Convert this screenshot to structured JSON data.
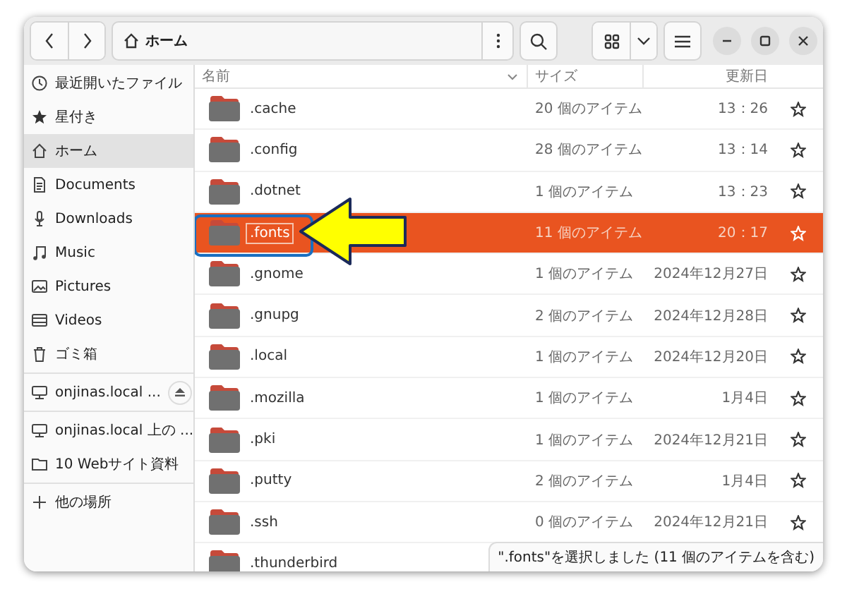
{
  "header": {
    "location": "ホーム"
  },
  "sidebar": {
    "sections": [
      [
        {
          "label": "最近開いたファイル",
          "selected": false
        },
        {
          "label": "星付き",
          "selected": false
        },
        {
          "label": "ホーム",
          "selected": true
        },
        {
          "label": "Documents",
          "selected": false
        },
        {
          "label": "Downloads",
          "selected": false
        },
        {
          "label": "Music",
          "selected": false
        },
        {
          "label": "Pictures",
          "selected": false
        },
        {
          "label": "Videos",
          "selected": false
        },
        {
          "label": "ゴミ箱",
          "selected": false
        }
      ],
      [
        {
          "label": "onjinas.local ...",
          "selected": false,
          "eject": true
        }
      ],
      [
        {
          "label": "onjinas.local 上の ...",
          "selected": false
        },
        {
          "label": "10 Webサイト資料",
          "selected": false
        }
      ],
      [
        {
          "label": "他の場所",
          "selected": false
        }
      ]
    ]
  },
  "table": {
    "columns": [
      "名前",
      "サイズ",
      "更新日"
    ],
    "rows": [
      {
        "name": ".cache",
        "size": "20 個のアイテム",
        "modified": "13：26",
        "selected": false,
        "starred": false
      },
      {
        "name": ".config",
        "size": "28 個のアイテム",
        "modified": "13：14",
        "selected": false,
        "starred": false
      },
      {
        "name": ".dotnet",
        "size": "1 個のアイテム",
        "modified": "13：23",
        "selected": false,
        "starred": false
      },
      {
        "name": ".fonts",
        "size": "11 個のアイテム",
        "modified": "20：17",
        "selected": true,
        "starred": false
      },
      {
        "name": ".gnome",
        "size": "1 個のアイテム",
        "modified": "2024年12月27日",
        "selected": false,
        "starred": false
      },
      {
        "name": ".gnupg",
        "size": "2 個のアイテム",
        "modified": "2024年12月28日",
        "selected": false,
        "starred": false
      },
      {
        "name": ".local",
        "size": "1 個のアイテム",
        "modified": "2024年12月20日",
        "selected": false,
        "starred": false
      },
      {
        "name": ".mozilla",
        "size": "1 個のアイテム",
        "modified": "1月4日",
        "selected": false,
        "starred": false
      },
      {
        "name": ".pki",
        "size": "1 個のアイテム",
        "modified": "2024年12月21日",
        "selected": false,
        "starred": false
      },
      {
        "name": ".putty",
        "size": "2 個のアイテム",
        "modified": "1月4日",
        "selected": false,
        "starred": false
      },
      {
        "name": ".ssh",
        "size": "0 個のアイテム",
        "modified": "2024年12月21日",
        "selected": false,
        "starred": false
      },
      {
        "name": ".thunderbird",
        "selected": false
      }
    ]
  },
  "status_bar": "\".fonts\"を選択しました (11 個のアイテムを含む)"
}
